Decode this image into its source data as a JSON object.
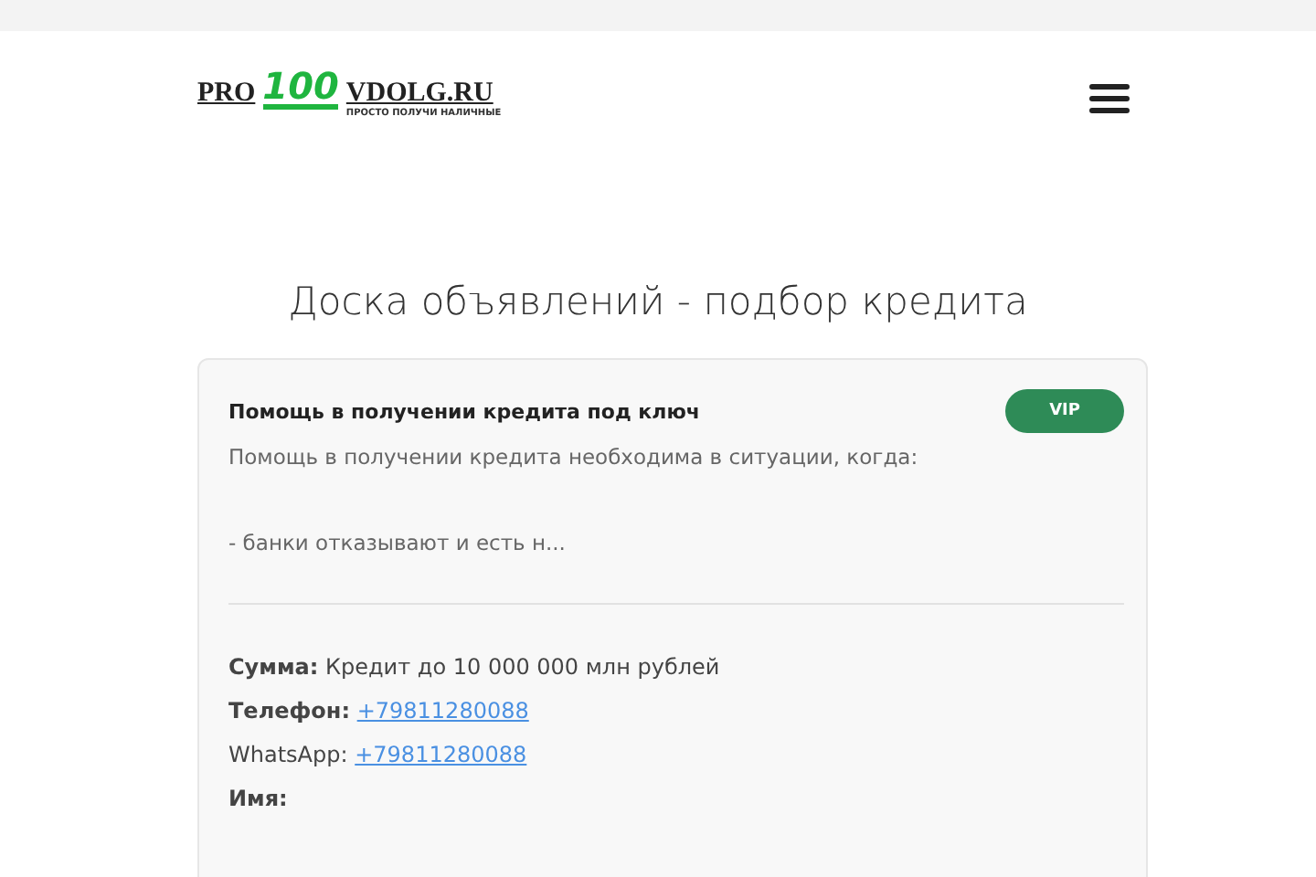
{
  "logo": {
    "left": "PRO",
    "number": "100",
    "right": "VDOLG.RU",
    "tagline": "ПРОСТО ПОЛУЧИ НАЛИЧНЫЕ"
  },
  "heading": "Доска объявлений - подбор кредита",
  "listing": {
    "title": "Помощь в получении кредита под ключ",
    "badge": "VIP",
    "description": [
      "Помощь в получении кредита необходима в ситуации, когда:",
      "- банки отказывают и есть н..."
    ],
    "fields": [
      {
        "label": "Сумма:",
        "bold": true,
        "kind": "text",
        "value": "Кредит до 10 000 000 млн рублей"
      },
      {
        "label": "Телефон:",
        "bold": true,
        "kind": "link",
        "value": "+79811280088"
      },
      {
        "label": "WhatsApp:",
        "bold": false,
        "kind": "link",
        "value": "+79811280088"
      },
      {
        "label": "Имя:",
        "bold": true,
        "kind": "none"
      }
    ]
  }
}
